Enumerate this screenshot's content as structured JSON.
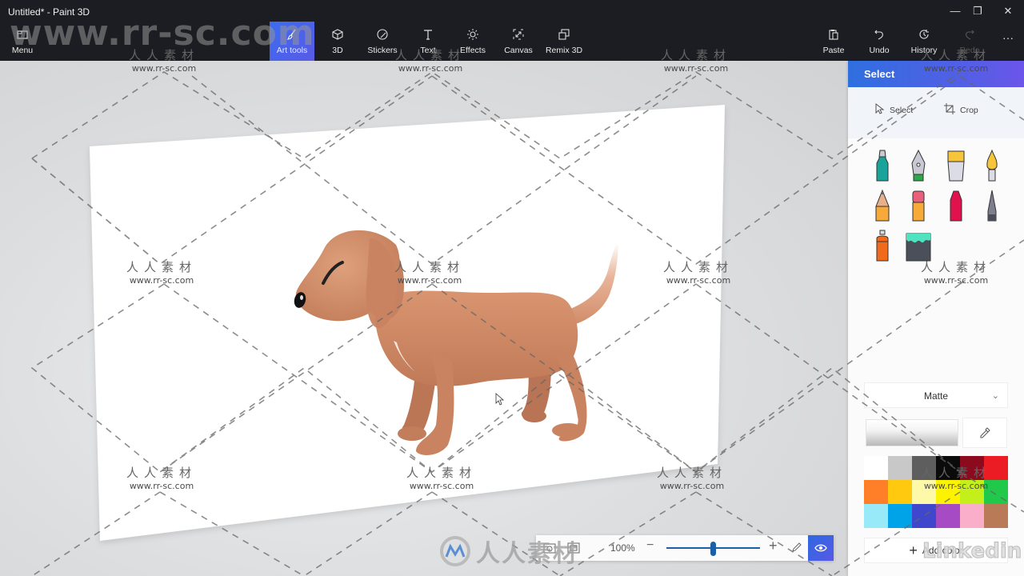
{
  "window": {
    "title": "Untitled* - Paint 3D",
    "controls": {
      "minimize": "—",
      "restore": "❐",
      "close": "✕"
    }
  },
  "toolbar": {
    "menu": {
      "label": "Menu",
      "icon": "menu-folder-icon"
    },
    "tabs": [
      {
        "label": "Art tools",
        "icon": "brush-icon",
        "active": true
      },
      {
        "label": "3D",
        "icon": "cube-icon"
      },
      {
        "label": "Stickers",
        "icon": "sticker-icon"
      },
      {
        "label": "Text",
        "icon": "text-icon"
      },
      {
        "label": "Effects",
        "icon": "sun-icon"
      },
      {
        "label": "Canvas",
        "icon": "canvas-resize-icon"
      },
      {
        "label": "Remix 3D",
        "icon": "remix-icon"
      }
    ],
    "actions": [
      {
        "label": "Paste",
        "icon": "paste-icon"
      },
      {
        "label": "Undo",
        "icon": "undo-icon"
      },
      {
        "label": "History",
        "icon": "history-icon"
      },
      {
        "label": "Redo",
        "icon": "redo-icon",
        "disabled": true
      }
    ],
    "more": "···"
  },
  "panel": {
    "header": "Select",
    "select_label": "Select",
    "crop_label": "Crop",
    "brushes": [
      "marker",
      "calligraphy-pen",
      "oil-brush",
      "watercolor",
      "pencil",
      "eraser",
      "crayon",
      "pixel-pen",
      "spray-can",
      "fill-bucket"
    ],
    "material": "Matte",
    "current_color": "#ffffff",
    "palette": [
      "#ffffff",
      "#c8c8c8",
      "#5e5e5e",
      "#0b0b0b",
      "#8b0a1e",
      "#ec1c24",
      "#fe7f27",
      "#fec90e",
      "#fdf9a8",
      "#fdf200",
      "#c4ef1a",
      "#21c94a",
      "#99eaf8",
      "#00a2e8",
      "#3f47cc",
      "#a64bc3",
      "#fbaec9",
      "#b97a57"
    ],
    "add_color_label": "Add color"
  },
  "zoombar": {
    "zoom_percent": "100%",
    "minus": "−",
    "plus": "+",
    "slider_value": 0.5
  },
  "watermark": {
    "big_url": "www.rr-sc.com",
    "cn": "人人素材",
    "url": "www.rr-sc.com",
    "logo_text": "人人素材",
    "linkedin": "Linkedin"
  }
}
